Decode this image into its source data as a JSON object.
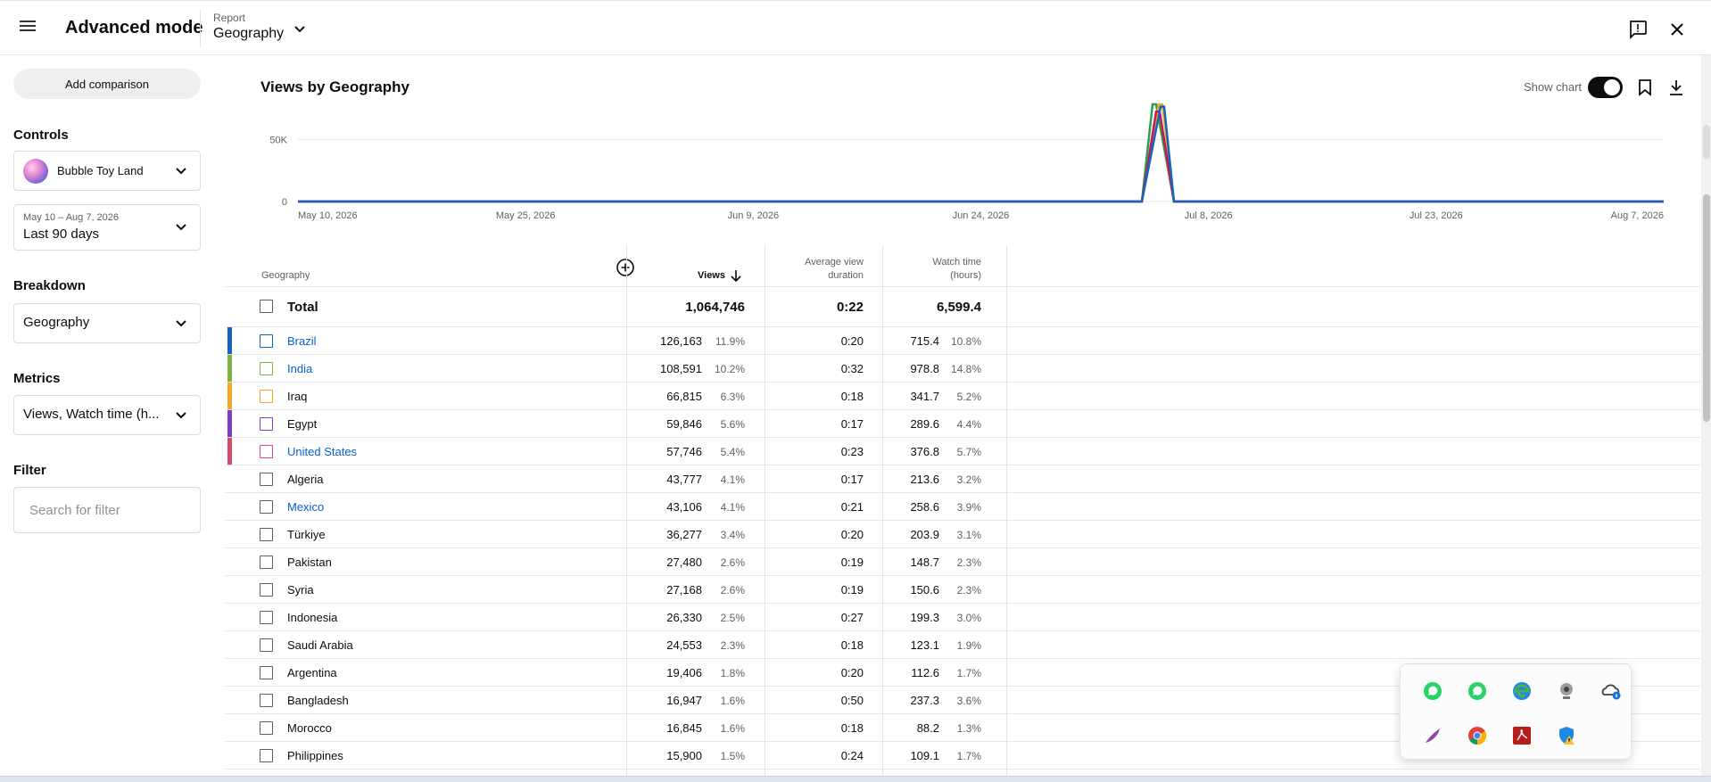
{
  "header": {
    "app_title": "Advanced mode",
    "report_label": "Report",
    "report_name": "Geography"
  },
  "sidebar": {
    "add_comparison": "Add comparison",
    "controls_label": "Controls",
    "channel_name": "Bubble Toy Land",
    "date_range_small": "May 10 – Aug 7, 2026",
    "date_range": "Last 90 days",
    "breakdown_label": "Breakdown",
    "breakdown_value": "Geography",
    "metrics_label": "Metrics",
    "metrics_value": "Views, Watch time (h...",
    "filter_label": "Filter",
    "filter_placeholder": "Search for filter"
  },
  "chart": {
    "title": "Views by Geography",
    "show_chart_label": "Show chart"
  },
  "chart_data": {
    "type": "line",
    "y_tick_labels": [
      "50K",
      "0"
    ],
    "x_tick_labels": [
      "May 10, 2026",
      "May 25, 2026",
      "Jun 9, 2026",
      "Jun 24, 2026",
      "Jul 8, 2026",
      "Jul 23, 2026",
      "Aug 7, 2026"
    ],
    "ylim": [
      0,
      60000
    ],
    "spike_date_range": [
      "Jul 4, 2026",
      "Jul 7, 2026"
    ],
    "series": [
      {
        "color": "#2e9e4b",
        "peak": 60000
      },
      {
        "color": "#f5a623",
        "peak": 60000
      },
      {
        "color": "#c2185b",
        "peak": 55000
      },
      {
        "color": "#1565c0",
        "peak": 58000
      }
    ]
  },
  "table": {
    "col_geography": "Geography",
    "col_views": "Views",
    "col_avg_line1": "Average view",
    "col_avg_line2": "duration",
    "col_watch_line1": "Watch time",
    "col_watch_line2": "(hours)",
    "total": {
      "name": "Total",
      "views": "1,064,746",
      "avg": "0:22",
      "watch": "6,599.4"
    },
    "rows": [
      {
        "name": "Brazil",
        "views": "126,163",
        "views_pct": "11.9%",
        "avg": "0:20",
        "watch": "715.4",
        "watch_pct": "10.8%",
        "link": true,
        "color": "#1565c0"
      },
      {
        "name": "India",
        "views": "108,591",
        "views_pct": "10.2%",
        "avg": "0:32",
        "watch": "978.8",
        "watch_pct": "14.8%",
        "link": true,
        "color": "#7cb342"
      },
      {
        "name": "Iraq",
        "views": "66,815",
        "views_pct": "6.3%",
        "avg": "0:18",
        "watch": "341.7",
        "watch_pct": "5.2%",
        "link": false,
        "color": "#f5a623"
      },
      {
        "name": "Egypt",
        "views": "59,846",
        "views_pct": "5.6%",
        "avg": "0:17",
        "watch": "289.6",
        "watch_pct": "4.4%",
        "link": false,
        "color": "#7b3fc4"
      },
      {
        "name": "United States",
        "views": "57,746",
        "views_pct": "5.4%",
        "avg": "0:23",
        "watch": "376.8",
        "watch_pct": "5.7%",
        "link": true,
        "color": "#d6486e"
      },
      {
        "name": "Algeria",
        "views": "43,777",
        "views_pct": "4.1%",
        "avg": "0:17",
        "watch": "213.6",
        "watch_pct": "3.2%",
        "link": false,
        "color": ""
      },
      {
        "name": "Mexico",
        "views": "43,106",
        "views_pct": "4.1%",
        "avg": "0:21",
        "watch": "258.6",
        "watch_pct": "3.9%",
        "link": true,
        "color": ""
      },
      {
        "name": "Türkiye",
        "views": "36,277",
        "views_pct": "3.4%",
        "avg": "0:20",
        "watch": "203.9",
        "watch_pct": "3.1%",
        "link": false,
        "color": ""
      },
      {
        "name": "Pakistan",
        "views": "27,480",
        "views_pct": "2.6%",
        "avg": "0:19",
        "watch": "148.7",
        "watch_pct": "2.3%",
        "link": false,
        "color": ""
      },
      {
        "name": "Syria",
        "views": "27,168",
        "views_pct": "2.6%",
        "avg": "0:19",
        "watch": "150.6",
        "watch_pct": "2.3%",
        "link": false,
        "color": ""
      },
      {
        "name": "Indonesia",
        "views": "26,330",
        "views_pct": "2.5%",
        "avg": "0:27",
        "watch": "199.3",
        "watch_pct": "3.0%",
        "link": false,
        "color": ""
      },
      {
        "name": "Saudi Arabia",
        "views": "24,553",
        "views_pct": "2.3%",
        "avg": "0:18",
        "watch": "123.1",
        "watch_pct": "1.9%",
        "link": false,
        "color": ""
      },
      {
        "name": "Argentina",
        "views": "19,406",
        "views_pct": "1.8%",
        "avg": "0:20",
        "watch": "112.6",
        "watch_pct": "1.7%",
        "link": false,
        "color": ""
      },
      {
        "name": "Bangladesh",
        "views": "16,947",
        "views_pct": "1.6%",
        "avg": "0:50",
        "watch": "237.3",
        "watch_pct": "3.6%",
        "link": false,
        "color": ""
      },
      {
        "name": "Morocco",
        "views": "16,845",
        "views_pct": "1.6%",
        "avg": "0:18",
        "watch": "88.2",
        "watch_pct": "1.3%",
        "link": false,
        "color": ""
      },
      {
        "name": "Philippines",
        "views": "15,900",
        "views_pct": "1.5%",
        "avg": "0:24",
        "watch": "109.1",
        "watch_pct": "1.7%",
        "link": false,
        "color": ""
      }
    ]
  },
  "tray_icons": [
    "whatsapp-icon",
    "whatsapp-icon",
    "edge-icon",
    "webcam-icon",
    "onedrive-icon",
    "feather-icon",
    "chrome-icon",
    "pdf-icon",
    "defender-warning-icon"
  ]
}
